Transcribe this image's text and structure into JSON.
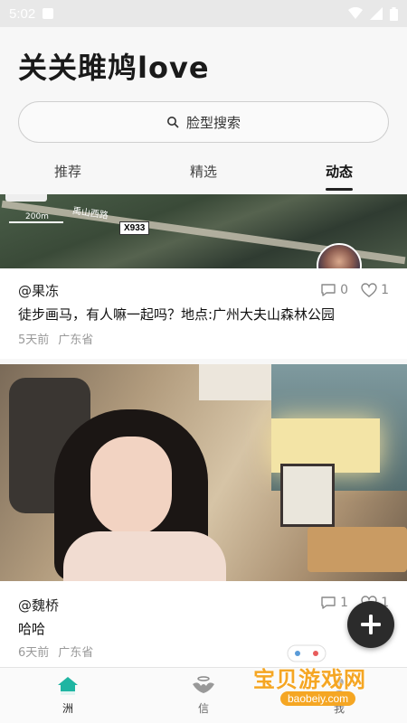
{
  "status_bar": {
    "time": "5:02"
  },
  "header": {
    "title": "关关雎鸠love",
    "search": {
      "label": "脸型搜索"
    },
    "tabs": [
      {
        "label": "推荐",
        "active": false
      },
      {
        "label": "精选",
        "active": false
      },
      {
        "label": "动态",
        "active": true
      }
    ]
  },
  "feed": {
    "posts": [
      {
        "image_labels": {
          "scale": "200m",
          "road": "禹山西路",
          "road_tag": "X933"
        },
        "author": "@果冻",
        "content": "徒步画马，有人嘛一起吗？地点:广州大夫山森林公园",
        "time": "5天前",
        "location": "广东省",
        "comments": "0",
        "likes": "1"
      },
      {
        "author": "@魏桥",
        "content": "哈哈",
        "time": "6天前",
        "location": "广东省",
        "comments": "1",
        "likes": "1"
      }
    ]
  },
  "bottom_nav": {
    "items": [
      {
        "label": "洲",
        "active": true
      },
      {
        "label": "信",
        "active": false
      },
      {
        "label": "我",
        "active": false
      }
    ]
  },
  "watermark": {
    "text": "宝贝游戏网",
    "url": "baobeiy.com"
  },
  "colors": {
    "accent": "#1fb5a2",
    "fab": "#2b2b2b",
    "watermark": "#f5a623"
  }
}
